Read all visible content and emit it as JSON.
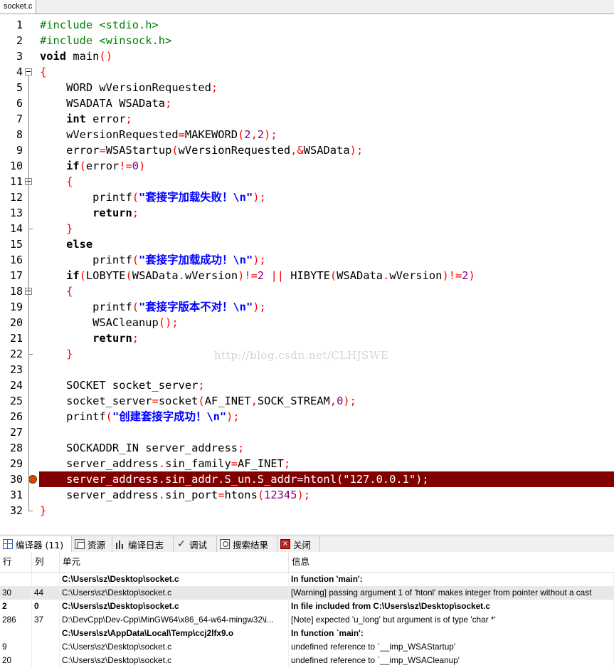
{
  "file_tab": "socket.c",
  "code_lines": [
    {
      "n": "1",
      "tokens": [
        {
          "t": "#include <stdio.h>",
          "c": "pp"
        }
      ]
    },
    {
      "n": "2",
      "tokens": [
        {
          "t": "#include <winsock.h>",
          "c": "pp"
        }
      ]
    },
    {
      "n": "3",
      "tokens": [
        {
          "t": "void",
          "c": "kw"
        },
        {
          "t": " main"
        },
        {
          "t": "()",
          "c": "sym"
        }
      ]
    },
    {
      "n": "4",
      "tokens": [
        {
          "t": "{",
          "c": "sym"
        }
      ]
    },
    {
      "n": "5",
      "tokens": [
        {
          "t": "    WORD wVersionRequested"
        },
        {
          "t": ";",
          "c": "sym"
        }
      ]
    },
    {
      "n": "6",
      "tokens": [
        {
          "t": "    WSADATA WSAData"
        },
        {
          "t": ";",
          "c": "sym"
        }
      ]
    },
    {
      "n": "7",
      "tokens": [
        {
          "t": "    "
        },
        {
          "t": "int",
          "c": "kw"
        },
        {
          "t": " error"
        },
        {
          "t": ";",
          "c": "sym"
        }
      ]
    },
    {
      "n": "8",
      "tokens": [
        {
          "t": "    wVersionRequested"
        },
        {
          "t": "=",
          "c": "sym"
        },
        {
          "t": "MAKEWORD"
        },
        {
          "t": "(",
          "c": "sym"
        },
        {
          "t": "2",
          "c": "num"
        },
        {
          "t": ",",
          "c": "sym"
        },
        {
          "t": "2",
          "c": "num"
        },
        {
          "t": ");",
          "c": "sym"
        }
      ]
    },
    {
      "n": "9",
      "tokens": [
        {
          "t": "    error"
        },
        {
          "t": "=",
          "c": "sym"
        },
        {
          "t": "WSAStartup"
        },
        {
          "t": "(",
          "c": "sym"
        },
        {
          "t": "wVersionRequested"
        },
        {
          "t": ",&",
          "c": "sym"
        },
        {
          "t": "WSAData"
        },
        {
          "t": ");",
          "c": "sym"
        }
      ]
    },
    {
      "n": "10",
      "tokens": [
        {
          "t": "    "
        },
        {
          "t": "if",
          "c": "kw"
        },
        {
          "t": "(",
          "c": "sym"
        },
        {
          "t": "error"
        },
        {
          "t": "!=",
          "c": "sym"
        },
        {
          "t": "0",
          "c": "num"
        },
        {
          "t": ")",
          "c": "sym"
        }
      ]
    },
    {
      "n": "11",
      "tokens": [
        {
          "t": "    "
        },
        {
          "t": "{",
          "c": "sym"
        }
      ]
    },
    {
      "n": "12",
      "tokens": [
        {
          "t": "        printf"
        },
        {
          "t": "(",
          "c": "sym"
        },
        {
          "t": "\"套接字加载失败！\\n\"",
          "c": "strb"
        },
        {
          "t": ");",
          "c": "sym"
        }
      ]
    },
    {
      "n": "13",
      "tokens": [
        {
          "t": "        "
        },
        {
          "t": "return",
          "c": "kw"
        },
        {
          "t": ";",
          "c": "sym"
        }
      ]
    },
    {
      "n": "14",
      "tokens": [
        {
          "t": "    "
        },
        {
          "t": "}",
          "c": "sym"
        }
      ]
    },
    {
      "n": "15",
      "tokens": [
        {
          "t": "    "
        },
        {
          "t": "else",
          "c": "kw"
        }
      ]
    },
    {
      "n": "16",
      "tokens": [
        {
          "t": "        printf"
        },
        {
          "t": "(",
          "c": "sym"
        },
        {
          "t": "\"套接字加载成功！\\n\"",
          "c": "strb"
        },
        {
          "t": ");",
          "c": "sym"
        }
      ]
    },
    {
      "n": "17",
      "tokens": [
        {
          "t": "    "
        },
        {
          "t": "if",
          "c": "kw"
        },
        {
          "t": "(",
          "c": "sym"
        },
        {
          "t": "LOBYTE"
        },
        {
          "t": "(",
          "c": "sym"
        },
        {
          "t": "WSAData"
        },
        {
          "t": ".",
          "c": "sym"
        },
        {
          "t": "wVersion"
        },
        {
          "t": ")!=",
          "c": "sym"
        },
        {
          "t": "2",
          "c": "num"
        },
        {
          "t": " || ",
          "c": "sym"
        },
        {
          "t": "HIBYTE"
        },
        {
          "t": "(",
          "c": "sym"
        },
        {
          "t": "WSAData"
        },
        {
          "t": ".",
          "c": "sym"
        },
        {
          "t": "wVersion"
        },
        {
          "t": ")!=",
          "c": "sym"
        },
        {
          "t": "2",
          "c": "num"
        },
        {
          "t": ")",
          "c": "sym"
        }
      ]
    },
    {
      "n": "18",
      "tokens": [
        {
          "t": "    "
        },
        {
          "t": "{",
          "c": "sym"
        }
      ]
    },
    {
      "n": "19",
      "tokens": [
        {
          "t": "        printf"
        },
        {
          "t": "(",
          "c": "sym"
        },
        {
          "t": "\"套接字版本不对！\\n\"",
          "c": "strb"
        },
        {
          "t": ");",
          "c": "sym"
        }
      ]
    },
    {
      "n": "20",
      "tokens": [
        {
          "t": "        WSACleanup"
        },
        {
          "t": "();",
          "c": "sym"
        }
      ]
    },
    {
      "n": "21",
      "tokens": [
        {
          "t": "        "
        },
        {
          "t": "return",
          "c": "kw"
        },
        {
          "t": ";",
          "c": "sym"
        }
      ]
    },
    {
      "n": "22",
      "tokens": [
        {
          "t": "    "
        },
        {
          "t": "}",
          "c": "sym"
        }
      ]
    },
    {
      "n": "23",
      "tokens": []
    },
    {
      "n": "24",
      "tokens": [
        {
          "t": "    SOCKET socket_server"
        },
        {
          "t": ";",
          "c": "sym"
        }
      ]
    },
    {
      "n": "25",
      "tokens": [
        {
          "t": "    socket_server"
        },
        {
          "t": "=",
          "c": "sym"
        },
        {
          "t": "socket"
        },
        {
          "t": "(",
          "c": "sym"
        },
        {
          "t": "AF_INET"
        },
        {
          "t": ",",
          "c": "sym"
        },
        {
          "t": "SOCK_STREAM"
        },
        {
          "t": ",",
          "c": "sym"
        },
        {
          "t": "0",
          "c": "num"
        },
        {
          "t": ");",
          "c": "sym"
        }
      ]
    },
    {
      "n": "26",
      "tokens": [
        {
          "t": "    printf"
        },
        {
          "t": "(",
          "c": "sym"
        },
        {
          "t": "\"创建套接字成功！\\n\"",
          "c": "strb"
        },
        {
          "t": ");",
          "c": "sym"
        }
      ]
    },
    {
      "n": "27",
      "tokens": []
    },
    {
      "n": "28",
      "tokens": [
        {
          "t": "    SOCKADDR_IN server_address"
        },
        {
          "t": ";",
          "c": "sym"
        }
      ]
    },
    {
      "n": "29",
      "tokens": [
        {
          "t": "    server_address"
        },
        {
          "t": ".",
          "c": "sym"
        },
        {
          "t": "sin_family"
        },
        {
          "t": "=",
          "c": "sym"
        },
        {
          "t": "AF_INET"
        },
        {
          "t": ";",
          "c": "sym"
        }
      ]
    },
    {
      "n": "30",
      "highlight": true,
      "tokens": [
        {
          "t": "    server_address.sin_addr.S_un.S_addr=htonl(\"127.0.0.1\");"
        }
      ]
    },
    {
      "n": "31",
      "tokens": [
        {
          "t": "    server_address"
        },
        {
          "t": ".",
          "c": "sym"
        },
        {
          "t": "sin_port"
        },
        {
          "t": "=",
          "c": "sym"
        },
        {
          "t": "htons"
        },
        {
          "t": "(",
          "c": "sym"
        },
        {
          "t": "12345",
          "c": "num"
        },
        {
          "t": ");",
          "c": "sym"
        }
      ]
    },
    {
      "n": "32",
      "tokens": [
        {
          "t": "}",
          "c": "sym"
        }
      ]
    }
  ],
  "watermark": "http://blog.csdn.net/CLHJSWE",
  "panel_tabs": [
    {
      "label": "编译器 (11)",
      "icon": "grid-icon",
      "active": true
    },
    {
      "label": "资源",
      "icon": "resource-icon"
    },
    {
      "label": "编译日志",
      "icon": "chart-icon"
    },
    {
      "label": "调试",
      "icon": "checkmark-icon"
    },
    {
      "label": "搜索结果",
      "icon": "find-icon"
    },
    {
      "label": "关闭",
      "icon": "close-icon"
    }
  ],
  "table": {
    "headers": [
      "行",
      "列",
      "单元",
      "信息"
    ],
    "rows": [
      {
        "line": "",
        "col": "",
        "unit": "C:\\Users\\sz\\Desktop\\socket.c",
        "msg": "In function 'main':",
        "bold": true
      },
      {
        "line": "30",
        "col": "44",
        "unit": "C:\\Users\\sz\\Desktop\\socket.c",
        "msg": "[Warning] passing argument 1 of 'htonl' makes integer from pointer without a cast",
        "selected": true
      },
      {
        "line": "2",
        "col": "0",
        "unit": "C:\\Users\\sz\\Desktop\\socket.c",
        "msg": "In file included from C:\\Users\\sz\\Desktop\\socket.c",
        "bold": true
      },
      {
        "line": "286",
        "col": "37",
        "unit": "D:\\DevCpp\\Dev-Cpp\\MinGW64\\x86_64-w64-mingw32\\i...",
        "msg": "[Note] expected 'u_long' but argument is of type 'char *'"
      },
      {
        "line": "",
        "col": "",
        "unit": "C:\\Users\\sz\\AppData\\Local\\Temp\\ccj2lfx9.o",
        "msg": "In function `main':",
        "bold": true
      },
      {
        "line": "9",
        "col": "",
        "unit": "C:\\Users\\sz\\Desktop\\socket.c",
        "msg": "undefined reference to `__imp_WSAStartup'"
      },
      {
        "line": "20",
        "col": "",
        "unit": "C:\\Users\\sz\\Desktop\\socket.c",
        "msg": "undefined reference to `__imp_WSACleanup'"
      }
    ]
  }
}
